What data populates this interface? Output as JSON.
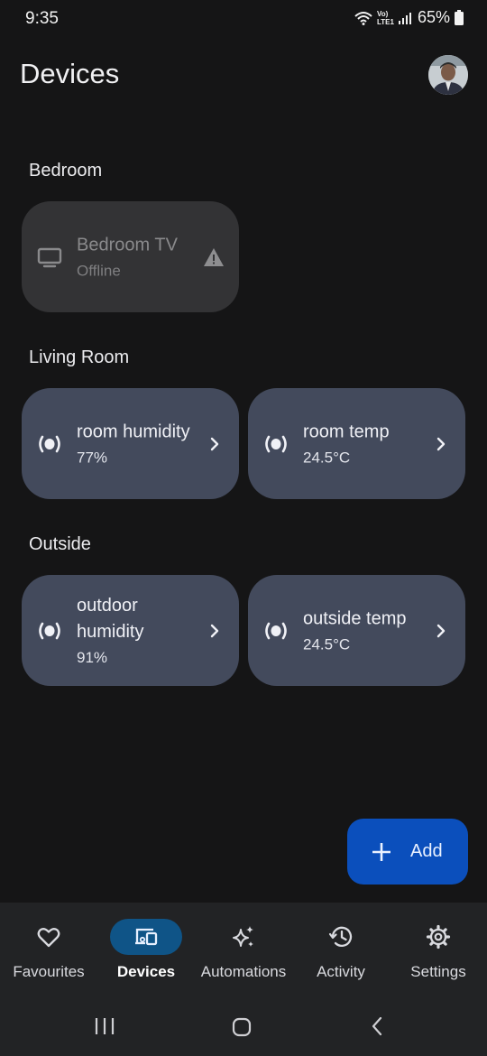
{
  "status": {
    "time": "9:35",
    "battery": "65%",
    "net_line1": "Vo)",
    "net_line2": "LTE1"
  },
  "header": {
    "title": "Devices",
    "avatar": "avatar"
  },
  "sections": [
    {
      "title": "Bedroom"
    },
    {
      "title": "Living Room"
    },
    {
      "title": "Outside"
    }
  ],
  "devices": {
    "bedroom_tv": {
      "name": "Bedroom TV",
      "value": "Offline",
      "icon": "tv-icon",
      "status_icon": "warning-icon"
    },
    "room_humidity": {
      "name": "room humidity",
      "value": "77%",
      "icon": "sensor-icon"
    },
    "room_temp": {
      "name": "room temp",
      "value": "24.5°C",
      "icon": "sensor-icon"
    },
    "outdoor_humidity": {
      "name": "outdoor humidity",
      "value": "91%",
      "icon": "sensor-icon"
    },
    "outside_temp": {
      "name": "outside temp",
      "value": "24.5°C",
      "icon": "sensor-icon"
    }
  },
  "fab": {
    "label": "Add",
    "icon": "plus-icon"
  },
  "nav": [
    {
      "label": "Favourites",
      "icon": "heart-icon"
    },
    {
      "label": "Devices",
      "icon": "devices-icon",
      "active": true
    },
    {
      "label": "Automations",
      "icon": "sparkle-icon"
    },
    {
      "label": "Activity",
      "icon": "history-icon"
    },
    {
      "label": "Settings",
      "icon": "gear-icon"
    }
  ],
  "colors": {
    "background": "#151516",
    "tile": "#434a5c",
    "tile_offline": "#333335",
    "fab": "#0b4fbc",
    "nav_active": "#0f5487"
  }
}
